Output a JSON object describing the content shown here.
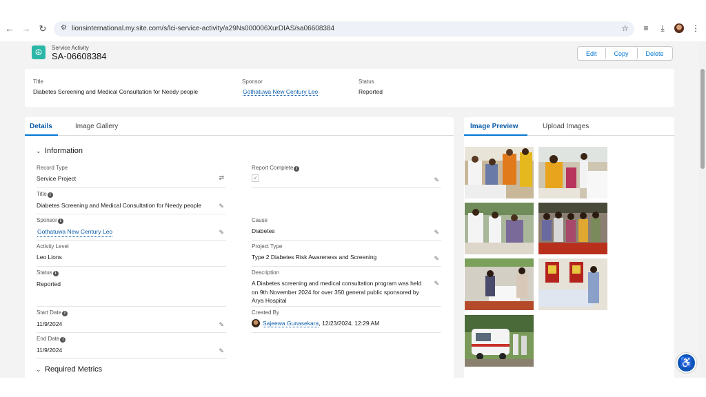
{
  "browser": {
    "url": "lionsinternational.my.site.com/s/lci-service-activity/a29Ns000006XurDIAS/sa06608384"
  },
  "header": {
    "object_type": "Service Activity",
    "record_id": "SA-06608384",
    "actions": [
      "Edit",
      "Copy",
      "Delete"
    ]
  },
  "highlights": {
    "title_label": "Title",
    "title_value": "Diabetes Screening and Medical Consultation for Needy people",
    "sponsor_label": "Sponsor",
    "sponsor_value": "Gothatuwa New Century Leo",
    "status_label": "Status",
    "status_value": "Reported"
  },
  "left_tabs": [
    "Details",
    "Image Gallery"
  ],
  "right_tabs": [
    "Image Preview",
    "Upload Images"
  ],
  "sections": {
    "information": "Information",
    "required_metrics": "Required Metrics"
  },
  "fields": {
    "record_type": {
      "label": "Record Type",
      "value": "Service Project"
    },
    "report_complete": {
      "label": "Report Complete",
      "checked": true
    },
    "title": {
      "label": "Title",
      "value": "Diabetes Screening and Medical Consultation for Needy people"
    },
    "sponsor": {
      "label": "Sponsor",
      "value": "Gothatuwa New Century Leo"
    },
    "cause": {
      "label": "Cause",
      "value": "Diabetes"
    },
    "activity_level": {
      "label": "Activity Level",
      "value": "Leo Lions"
    },
    "project_type": {
      "label": "Project Type",
      "value": "Type 2 Diabetes Risk Awareness and Screening"
    },
    "status": {
      "label": "Status",
      "value": "Reported"
    },
    "description": {
      "label": "Description",
      "value": "A Diabetes screening and medical consultation program was held on 9th November 2024 for over 350 general public sponsored by Arya Hospital"
    },
    "start_date": {
      "label": "Start Date",
      "value": "11/9/2024"
    },
    "created_by": {
      "label": "Created By",
      "user": "Sajeewa Gunasekara",
      "timestamp": ", 12/23/2024, 12:29 AM"
    },
    "end_date": {
      "label": "End Date",
      "value": "11/9/2024"
    }
  },
  "colors": {
    "brand_blue": "#0176d3",
    "link_blue": "#0b5cab",
    "icon_teal": "#2bb7a7"
  }
}
